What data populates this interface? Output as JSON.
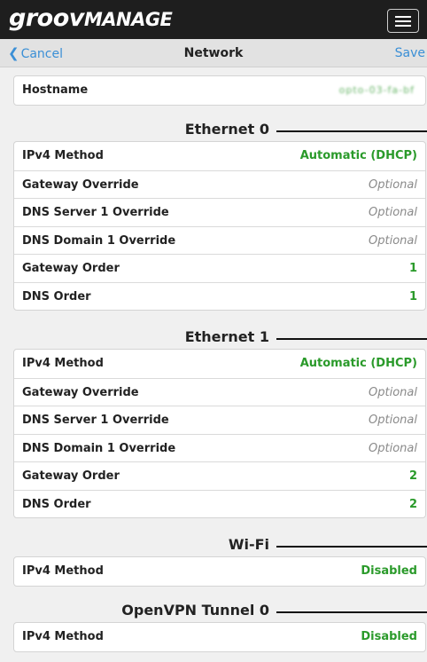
{
  "app": {
    "logo_main": "groov",
    "logo_sub": "MANAGE"
  },
  "nav": {
    "cancel": "Cancel",
    "title": "Network",
    "save": "Save"
  },
  "hostname": {
    "label": "Hostname",
    "value": "opto-03-fa-bf"
  },
  "eth0": {
    "title": "Ethernet 0",
    "rows": [
      {
        "label": "IPv4 Method",
        "value": "Automatic (DHCP)"
      },
      {
        "label": "Gateway Override",
        "value": "Optional"
      },
      {
        "label": "DNS Server 1 Override",
        "value": "Optional"
      },
      {
        "label": "DNS Domain 1 Override",
        "value": "Optional"
      },
      {
        "label": "Gateway Order",
        "value": "1"
      },
      {
        "label": "DNS Order",
        "value": "1"
      }
    ]
  },
  "eth1": {
    "title": "Ethernet 1",
    "rows": [
      {
        "label": "IPv4 Method",
        "value": "Automatic (DHCP)"
      },
      {
        "label": "Gateway Override",
        "value": "Optional"
      },
      {
        "label": "DNS Server 1 Override",
        "value": "Optional"
      },
      {
        "label": "DNS Domain 1 Override",
        "value": "Optional"
      },
      {
        "label": "Gateway Order",
        "value": "2"
      },
      {
        "label": "DNS Order",
        "value": "2"
      }
    ]
  },
  "wifi": {
    "title": "Wi-Fi",
    "rows": [
      {
        "label": "IPv4 Method",
        "value": "Disabled"
      }
    ]
  },
  "vpn": {
    "title": "OpenVPN Tunnel 0",
    "rows": [
      {
        "label": "IPv4 Method",
        "value": "Disabled"
      }
    ]
  },
  "colors": {
    "accent": "#3a8fd6",
    "value_green": "#2a9a2a",
    "placeholder": "#8a8a8a",
    "topbar": "#1e1e1e"
  },
  "icons": {
    "back": "chevron-left-icon",
    "menu": "hamburger-menu-icon"
  }
}
